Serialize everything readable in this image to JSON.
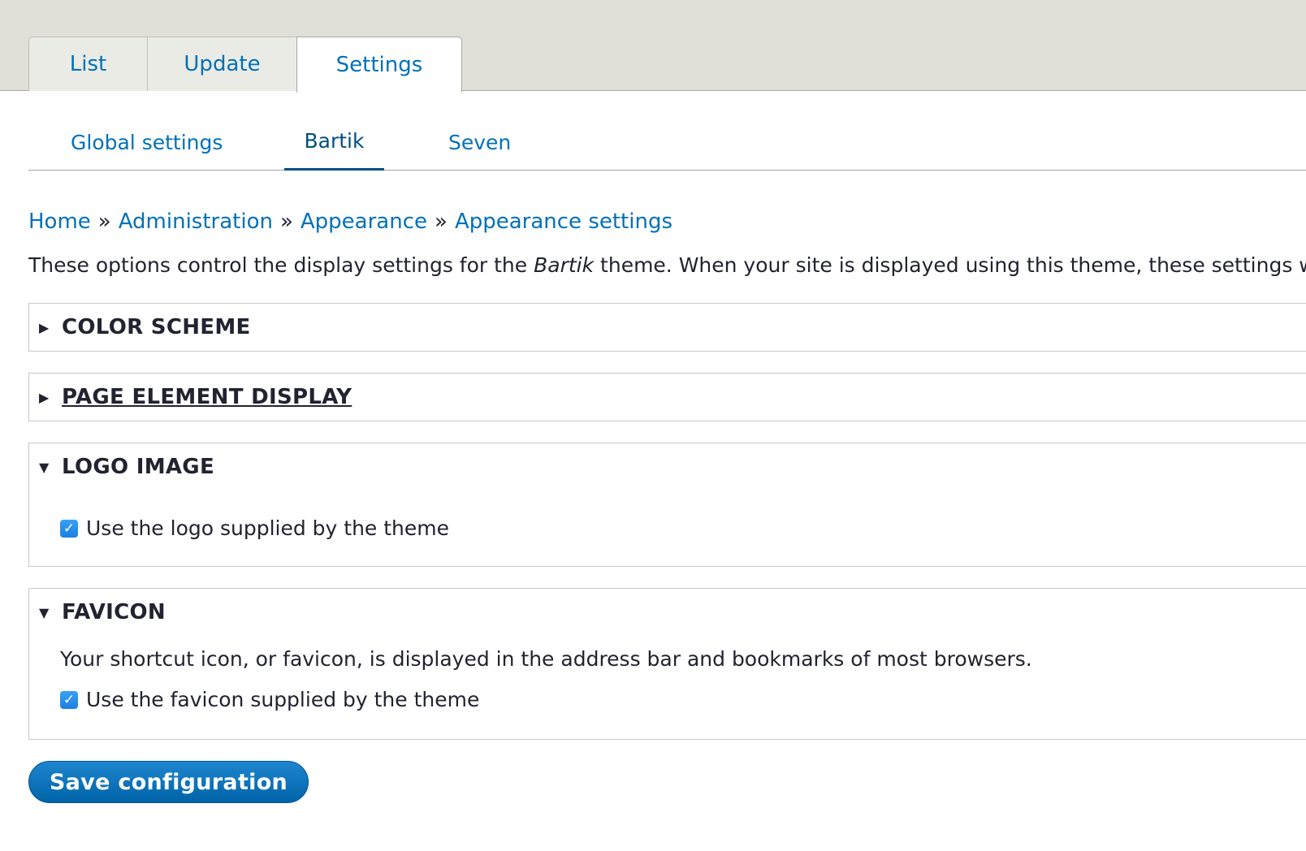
{
  "primary_tabs": [
    {
      "label": "List"
    },
    {
      "label": "Update"
    },
    {
      "label": "Settings",
      "active": true
    }
  ],
  "secondary_tabs": [
    {
      "label": "Global settings"
    },
    {
      "label": "Bartik",
      "active": true
    },
    {
      "label": "Seven"
    }
  ],
  "breadcrumb": {
    "items": [
      "Home",
      "Administration",
      "Appearance",
      "Appearance settings"
    ],
    "separator": "»"
  },
  "description": {
    "before": "These options control the display settings for the ",
    "theme_name": "Bartik",
    "after": " theme. When your site is displayed using this theme, these settings will be used."
  },
  "sections": {
    "color_scheme": {
      "label": "COLOR SCHEME",
      "expanded": false
    },
    "page_element_display": {
      "label": "PAGE ELEMENT DISPLAY",
      "expanded": false
    },
    "logo_image": {
      "label": "LOGO IMAGE",
      "expanded": true,
      "checkbox_label": "Use the logo supplied by the theme",
      "checked": true
    },
    "favicon": {
      "label": "FAVICON",
      "expanded": true,
      "description": "Your shortcut icon, or favicon, is displayed in the address bar and bookmarks of most browsers.",
      "checkbox_label": "Use the favicon supplied by the theme",
      "checked": true
    }
  },
  "actions": {
    "save_label": "Save configuration"
  },
  "colors": {
    "link": "#0071b8",
    "active_tab": "#004f80",
    "button": "#0071b8",
    "tab_bar": "#e0e0d8"
  }
}
